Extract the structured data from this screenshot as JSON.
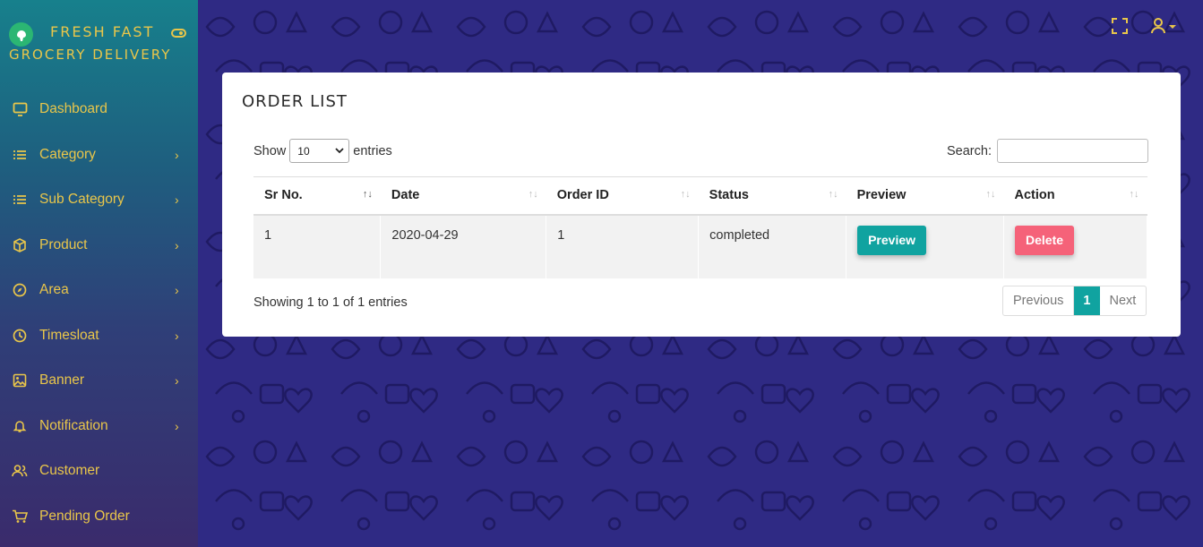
{
  "brand": {
    "line1": "FRESH FAST",
    "line2": "GROCERY DELIVERY"
  },
  "colors": {
    "accent": "#10a3a0",
    "danger": "#f56279",
    "sidebar_text": "#e9c64a",
    "background": "#2f2a84"
  },
  "sidebar": {
    "items": [
      {
        "label": "Dashboard",
        "icon": "monitor-icon",
        "chevron": ""
      },
      {
        "label": "Category",
        "icon": "list-icon",
        "chevron": "›"
      },
      {
        "label": "Sub Category",
        "icon": "list-icon",
        "chevron": "›"
      },
      {
        "label": "Product",
        "icon": "box-icon",
        "chevron": "›"
      },
      {
        "label": "Area",
        "icon": "compass-icon",
        "chevron": "›"
      },
      {
        "label": "Timesloat",
        "icon": "clock-icon",
        "chevron": "›"
      },
      {
        "label": "Banner",
        "icon": "image-icon",
        "chevron": "›"
      },
      {
        "label": "Notification",
        "icon": "bell-icon",
        "chevron": "›"
      },
      {
        "label": "Customer",
        "icon": "users-icon",
        "chevron": ""
      },
      {
        "label": "Pending Order",
        "icon": "cart-icon",
        "chevron": ""
      }
    ]
  },
  "page": {
    "title": "ORDER LIST",
    "show_label": "Show",
    "entries_label": "entries",
    "page_size": "10",
    "search_label": "Search:",
    "search_value": ""
  },
  "table": {
    "columns": [
      "Sr No.",
      "Date",
      "Order ID",
      "Status",
      "Preview",
      "Action"
    ],
    "rows": [
      {
        "sr": "1",
        "date": "2020-04-29",
        "order_id": "1",
        "status": "completed",
        "preview_label": "Preview",
        "action_label": "Delete"
      }
    ]
  },
  "footer": {
    "info": "Showing 1 to 1 of 1 entries",
    "prev_label": "Previous",
    "current_page": "1",
    "next_label": "Next"
  }
}
